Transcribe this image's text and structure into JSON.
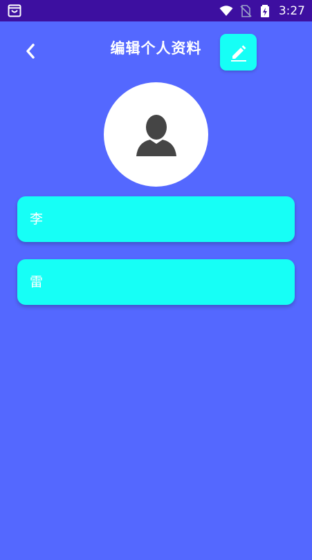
{
  "status_bar": {
    "left_icon": "shopping-bag-icon",
    "icons": [
      "wifi-icon",
      "no-sim-icon",
      "battery-charging-icon"
    ],
    "time": "3:27"
  },
  "header": {
    "title": "编辑个人资料",
    "back_icon": "chevron-left-icon",
    "edit_icon": "pencil-icon"
  },
  "avatar": {
    "icon": "user-silhouette-icon"
  },
  "form": {
    "fields": [
      {
        "value": "李"
      },
      {
        "value": "雷"
      }
    ]
  },
  "colors": {
    "background": "#5468ff",
    "status_bar": "#3d0fa0",
    "accent": "#16fff6",
    "text": "#ffffff"
  }
}
